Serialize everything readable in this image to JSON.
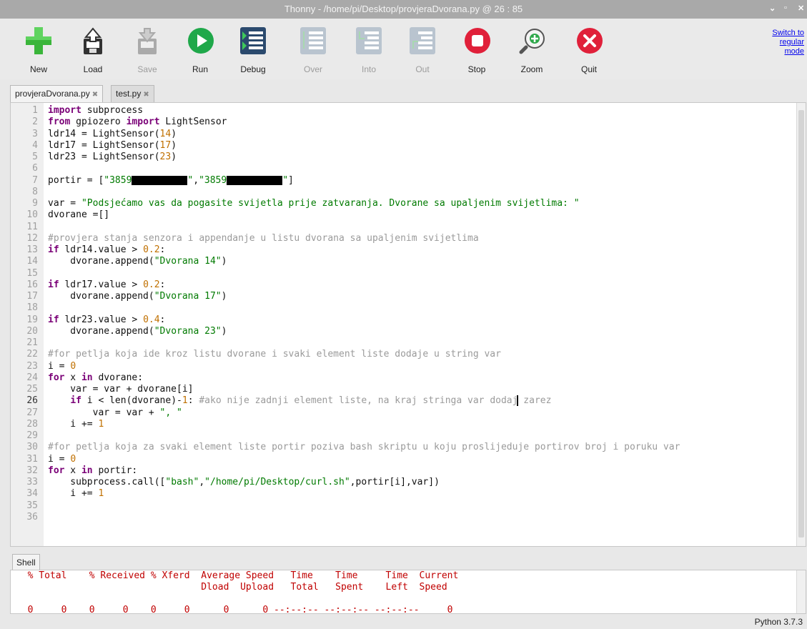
{
  "window": {
    "title": "Thonny  -  /home/pi/Desktop/provjeraDvorana.py  @  26 : 85",
    "controls": [
      "⌄",
      "▫",
      "✕"
    ]
  },
  "toolbar": {
    "buttons": [
      {
        "label": "New",
        "icon": "new-icon",
        "enabled": true
      },
      {
        "label": "Load",
        "icon": "load-icon",
        "enabled": true
      },
      {
        "label": "Save",
        "icon": "save-icon",
        "enabled": false
      },
      {
        "label": "Run",
        "icon": "run-icon",
        "enabled": true
      },
      {
        "label": "Debug",
        "icon": "debug-icon",
        "enabled": true
      },
      {
        "label": "Over",
        "icon": "step-over-icon",
        "enabled": false
      },
      {
        "label": "Into",
        "icon": "step-into-icon",
        "enabled": false
      },
      {
        "label": "Out",
        "icon": "step-out-icon",
        "enabled": false
      },
      {
        "label": "Stop",
        "icon": "stop-icon",
        "enabled": true
      },
      {
        "label": "Zoom",
        "icon": "zoom-icon",
        "enabled": true
      },
      {
        "label": "Quit",
        "icon": "quit-icon",
        "enabled": true
      }
    ],
    "switch_mode": {
      "line1": "Switch to",
      "line2": "regular",
      "line3": "mode"
    }
  },
  "tabs": [
    {
      "label": "provjeraDvorana.py",
      "close": "✖",
      "active": true
    },
    {
      "label": "test.py",
      "close": "✖",
      "active": false
    }
  ],
  "editor": {
    "current_line": 26,
    "lines": [
      "import subprocess",
      "from gpiozero import LightSensor",
      "ldr14 = LightSensor(14)",
      "ldr17 = LightSensor(17)",
      "ldr23 = LightSensor(23)",
      "",
      "portir = [\"3859██████████\",\"3859██████████\"]",
      "",
      "var = \"Podsjećamo vas da pogasite svijetla prije zatvaranja. Dvorane sa upaljenim svijetlima: \"",
      "dvorane =[]",
      "",
      "#provjera stanja senzora i appendanje u listu dvorana sa upaljenim svijetlima",
      "if ldr14.value > 0.2:",
      "    dvorane.append(\"Dvorana 14\")",
      "",
      "if ldr17.value > 0.2:",
      "    dvorane.append(\"Dvorana 17\")",
      "",
      "if ldr23.value > 0.4:",
      "    dvorane.append(\"Dvorana 23\")",
      "",
      "#for petlja koja ide kroz listu dvorane i svaki element liste dodaje u string var",
      "i = 0",
      "for x in dvorane:",
      "    var = var + dvorane[i]",
      "    if i < len(dvorane)-1: #ako nije zadnji element liste, na kraj stringa var dodaj zarez",
      "        var = var + \", \"",
      "    i += 1",
      "",
      "#for petlja koja za svaki element liste portir poziva bash skriptu u koju proslijeduje portirov broj i poruku var",
      "i = 0",
      "for x in portir:",
      "    subprocess.call([\"bash\",\"/home/pi/Desktop/curl.sh\",portir[i],var])",
      "    i += 1",
      "",
      ""
    ]
  },
  "shell": {
    "tab_label": "Shell",
    "lines": [
      "  % Total    % Received % Xferd  Average Speed   Time    Time     Time  Current",
      "                                 Dload  Upload   Total   Spent    Left  Speed",
      "",
      "  0     0    0     0    0     0      0      0 --:--:-- --:--:-- --:--:--     0"
    ]
  },
  "status": {
    "python_version": "Python 3.7.3"
  }
}
